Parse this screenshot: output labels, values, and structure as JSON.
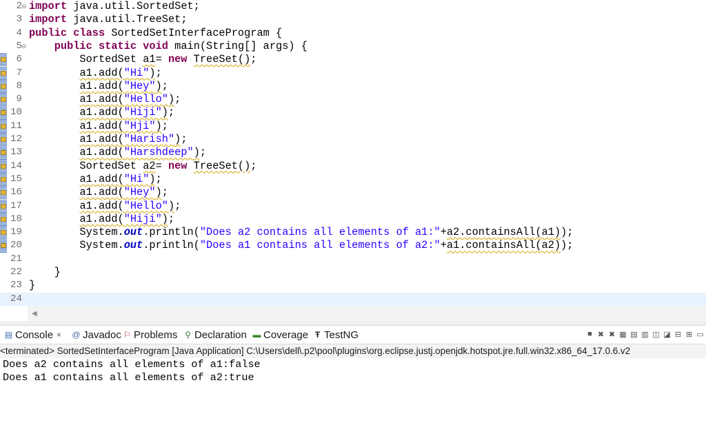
{
  "editor": {
    "lines": [
      {
        "n": "2",
        "fold": "⊖",
        "marker": false,
        "parts": [
          [
            "kw",
            "import"
          ],
          [
            "",
            "java.util.SortedSet;"
          ]
        ]
      },
      {
        "n": "3",
        "fold": "",
        "marker": false,
        "parts": [
          [
            "kw",
            "import"
          ],
          [
            "",
            "java.util.TreeSet;"
          ]
        ]
      },
      {
        "n": "4",
        "fold": "",
        "marker": false,
        "parts": [
          [
            "kw",
            "public"
          ],
          [
            "kw",
            "class"
          ],
          [
            "",
            "SortedSetInterfaceProgram {"
          ]
        ]
      },
      {
        "n": "5",
        "fold": "⊖",
        "marker": false,
        "parts": [
          [
            "",
            "    "
          ],
          [
            "kw",
            "public"
          ],
          [
            "kw",
            "static"
          ],
          [
            "kw",
            "void"
          ],
          [
            "",
            "main(String[] args) {"
          ]
        ]
      },
      {
        "n": "6",
        "fold": "",
        "marker": true,
        "parts": [
          [
            "",
            "        SortedSet "
          ],
          [
            "w",
            "a1"
          ],
          [
            "",
            "= "
          ],
          [
            "kw",
            "new"
          ],
          [
            "w",
            "TreeSet()"
          ],
          [
            "",
            ";"
          ]
        ]
      },
      {
        "n": "7",
        "fold": "",
        "marker": true,
        "parts": [
          [
            "",
            "        "
          ],
          [
            "w",
            "a1.add("
          ],
          [
            "ws",
            "\"Hi\""
          ],
          [
            "w",
            ")"
          ],
          [
            "",
            ";"
          ]
        ]
      },
      {
        "n": "8",
        "fold": "",
        "marker": true,
        "parts": [
          [
            "",
            "        "
          ],
          [
            "w",
            "a1.add("
          ],
          [
            "ws",
            "\"Hey\""
          ],
          [
            "w",
            ")"
          ],
          [
            "",
            ";"
          ]
        ]
      },
      {
        "n": "9",
        "fold": "",
        "marker": true,
        "parts": [
          [
            "",
            "        "
          ],
          [
            "w",
            "a1.add("
          ],
          [
            "ws",
            "\"Hello\""
          ],
          [
            "w",
            ")"
          ],
          [
            "",
            ";"
          ]
        ]
      },
      {
        "n": "10",
        "fold": "",
        "marker": true,
        "parts": [
          [
            "",
            "        "
          ],
          [
            "w",
            "a1.add("
          ],
          [
            "ws",
            "\"Hiji\""
          ],
          [
            "w",
            ")"
          ],
          [
            "",
            ";"
          ]
        ]
      },
      {
        "n": "11",
        "fold": "",
        "marker": true,
        "parts": [
          [
            "",
            "        "
          ],
          [
            "w",
            "a1.add("
          ],
          [
            "ws",
            "\"Hji\""
          ],
          [
            "w",
            ")"
          ],
          [
            "",
            ";"
          ]
        ]
      },
      {
        "n": "12",
        "fold": "",
        "marker": true,
        "parts": [
          [
            "",
            "        "
          ],
          [
            "w",
            "a1.add("
          ],
          [
            "ws",
            "\"Harish\""
          ],
          [
            "w",
            ")"
          ],
          [
            "",
            ";"
          ]
        ]
      },
      {
        "n": "13",
        "fold": "",
        "marker": true,
        "parts": [
          [
            "",
            "        "
          ],
          [
            "w",
            "a1.add("
          ],
          [
            "ws",
            "\"Harshdeep\""
          ],
          [
            "w",
            ")"
          ],
          [
            "",
            ";"
          ]
        ]
      },
      {
        "n": "14",
        "fold": "",
        "marker": true,
        "parts": [
          [
            "",
            "        SortedSet "
          ],
          [
            "w",
            "a2"
          ],
          [
            "",
            "= "
          ],
          [
            "kw",
            "new"
          ],
          [
            "w",
            "TreeSet()"
          ],
          [
            "",
            ";"
          ]
        ]
      },
      {
        "n": "15",
        "fold": "",
        "marker": true,
        "parts": [
          [
            "",
            "        "
          ],
          [
            "w",
            "a1.add("
          ],
          [
            "ws",
            "\"Hi\""
          ],
          [
            "w",
            ")"
          ],
          [
            "",
            ";"
          ]
        ]
      },
      {
        "n": "16",
        "fold": "",
        "marker": true,
        "parts": [
          [
            "",
            "        "
          ],
          [
            "w",
            "a1.add("
          ],
          [
            "ws",
            "\"Hey\""
          ],
          [
            "w",
            ")"
          ],
          [
            "",
            ";"
          ]
        ]
      },
      {
        "n": "17",
        "fold": "",
        "marker": true,
        "parts": [
          [
            "",
            "        "
          ],
          [
            "w",
            "a1.add("
          ],
          [
            "ws",
            "\"Hello\""
          ],
          [
            "w",
            ")"
          ],
          [
            "",
            ";"
          ]
        ]
      },
      {
        "n": "18",
        "fold": "",
        "marker": true,
        "parts": [
          [
            "",
            "        "
          ],
          [
            "w",
            "a1.add("
          ],
          [
            "ws",
            "\"Hiji\""
          ],
          [
            "w",
            ")"
          ],
          [
            "",
            ";"
          ]
        ]
      },
      {
        "n": "19",
        "fold": "",
        "marker": true,
        "parts": [
          [
            "",
            "        System."
          ],
          [
            "it",
            "out"
          ],
          [
            "",
            ".println("
          ],
          [
            "str",
            "\"Does a2 contains all elements of a1:\""
          ],
          [
            "",
            "+"
          ],
          [
            "w",
            "a2.containsAll(a1)"
          ],
          [
            "",
            ");"
          ]
        ]
      },
      {
        "n": "20",
        "fold": "",
        "marker": true,
        "parts": [
          [
            "",
            "        System."
          ],
          [
            "it",
            "out"
          ],
          [
            "",
            ".println("
          ],
          [
            "str",
            "\"Does a1 contains all elements of a2:\""
          ],
          [
            "",
            "+"
          ],
          [
            "w",
            "a1.containsAll(a2)"
          ],
          [
            "",
            ");"
          ]
        ]
      },
      {
        "n": "21",
        "fold": "",
        "marker": false,
        "parts": [
          [
            "",
            ""
          ]
        ]
      },
      {
        "n": "22",
        "fold": "",
        "marker": false,
        "parts": [
          [
            "",
            "    }"
          ]
        ]
      },
      {
        "n": "23",
        "fold": "",
        "marker": false,
        "parts": [
          [
            "",
            "}"
          ]
        ]
      },
      {
        "n": "24",
        "fold": "",
        "marker": false,
        "current": true,
        "parts": [
          [
            "",
            ""
          ]
        ]
      }
    ]
  },
  "tabs": {
    "console": {
      "label": "Console",
      "close": "×",
      "icon": "console-icon"
    },
    "javadoc": {
      "label": "Javadoc",
      "icon": "javadoc-icon"
    },
    "problems": {
      "label": "Problems",
      "icon": "problems-icon"
    },
    "declaration": {
      "label": "Declaration",
      "icon": "declaration-icon"
    },
    "coverage": {
      "label": "Coverage",
      "icon": "coverage-icon"
    },
    "testng": {
      "label": "TestNG",
      "icon": "testng-icon"
    }
  },
  "status_line": "<terminated> SortedSetInterfaceProgram [Java Application] C:\\Users\\dell\\.p2\\pool\\plugins\\org.eclipse.justj.openjdk.hotspot.jre.full.win32.x86_64_17.0.6.v2",
  "console_output": [
    "Does a2 contains all elements of a1:false",
    "Does a1 contains all elements of a2:true"
  ],
  "colors": {
    "keyword": "#7f0055",
    "string": "#2a00ff",
    "field": "#0000c0",
    "current_line": "#e8f2fe"
  }
}
